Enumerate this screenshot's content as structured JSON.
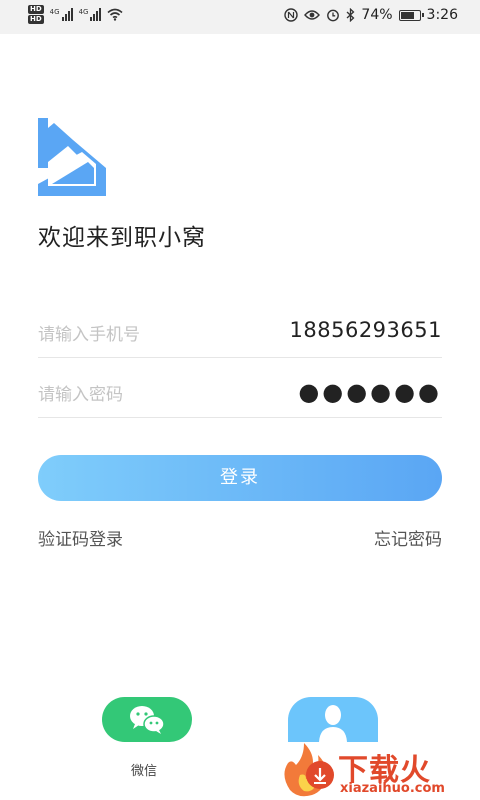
{
  "status_bar": {
    "sim1_label": "HD",
    "sim2_label": "HD",
    "net1": "4G",
    "net2": "4G",
    "battery_level": 0.74,
    "battery_text": "74%",
    "time": "3:26",
    "icons": [
      "wifi-icon",
      "nfc-icon",
      "eye-icon",
      "alarm-icon",
      "bluetooth-icon",
      "battery-icon"
    ]
  },
  "brand": {
    "logo_icon": "house-logo-icon",
    "logo_color": "#5aa6f4",
    "welcome_text": "欢迎来到职小窝"
  },
  "form": {
    "phone_placeholder": "请输入手机号",
    "phone_value": "18856293651",
    "password_placeholder": "请输入密码",
    "password_value": "●●●●●●"
  },
  "actions": {
    "login_label": "登录",
    "sms_login_label": "验证码登录",
    "forgot_password_label": "忘记密码"
  },
  "social": {
    "wechat_label": "微信",
    "wechat_color": "#33c877",
    "other_color": "#6cc5fb"
  },
  "watermark": {
    "text": "下载火",
    "url": "xiazaihuo.com",
    "color": "#e1492b"
  }
}
